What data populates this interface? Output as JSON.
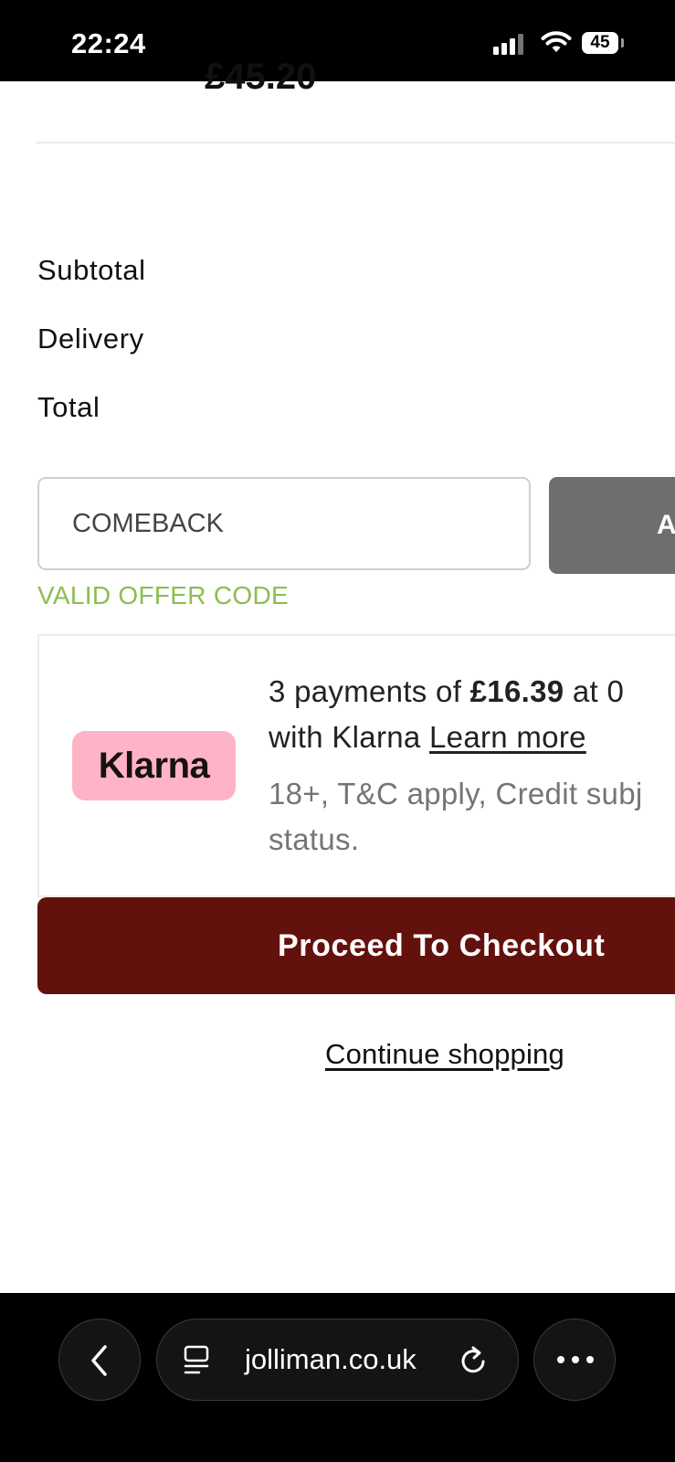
{
  "status_bar": {
    "time": "22:24",
    "battery": "45",
    "icons": [
      "signal-icon",
      "wifi-icon",
      "battery-icon"
    ]
  },
  "cart": {
    "clipped_price": "£45.20"
  },
  "summary": {
    "subtotal_label": "Subtotal",
    "delivery_label": "Delivery",
    "total_label": "Total"
  },
  "coupon": {
    "value": "COMEBACK",
    "apply_label": "A",
    "status": "VALID OFFER CODE",
    "status_color": "#8cbd4f"
  },
  "klarna": {
    "logo": "Klarna",
    "line1_prefix": "3 payments of ",
    "amount": "£16.39",
    "line1_suffix": " at 0",
    "line2_prefix": "with Klarna ",
    "learn_more": "Learn more",
    "disclaimer_line1": "18+, T&C apply, Credit subj",
    "disclaimer_line2": "status.",
    "badge_color": "#ffb3c7"
  },
  "checkout": {
    "proceed_label": "Proceed To Checkout",
    "continue_label": "Continue shopping",
    "button_color": "#63110d"
  },
  "browser": {
    "url": "jolliman.co.uk",
    "icons": [
      "back-icon",
      "page-icon",
      "reload-icon",
      "more-icon"
    ]
  }
}
